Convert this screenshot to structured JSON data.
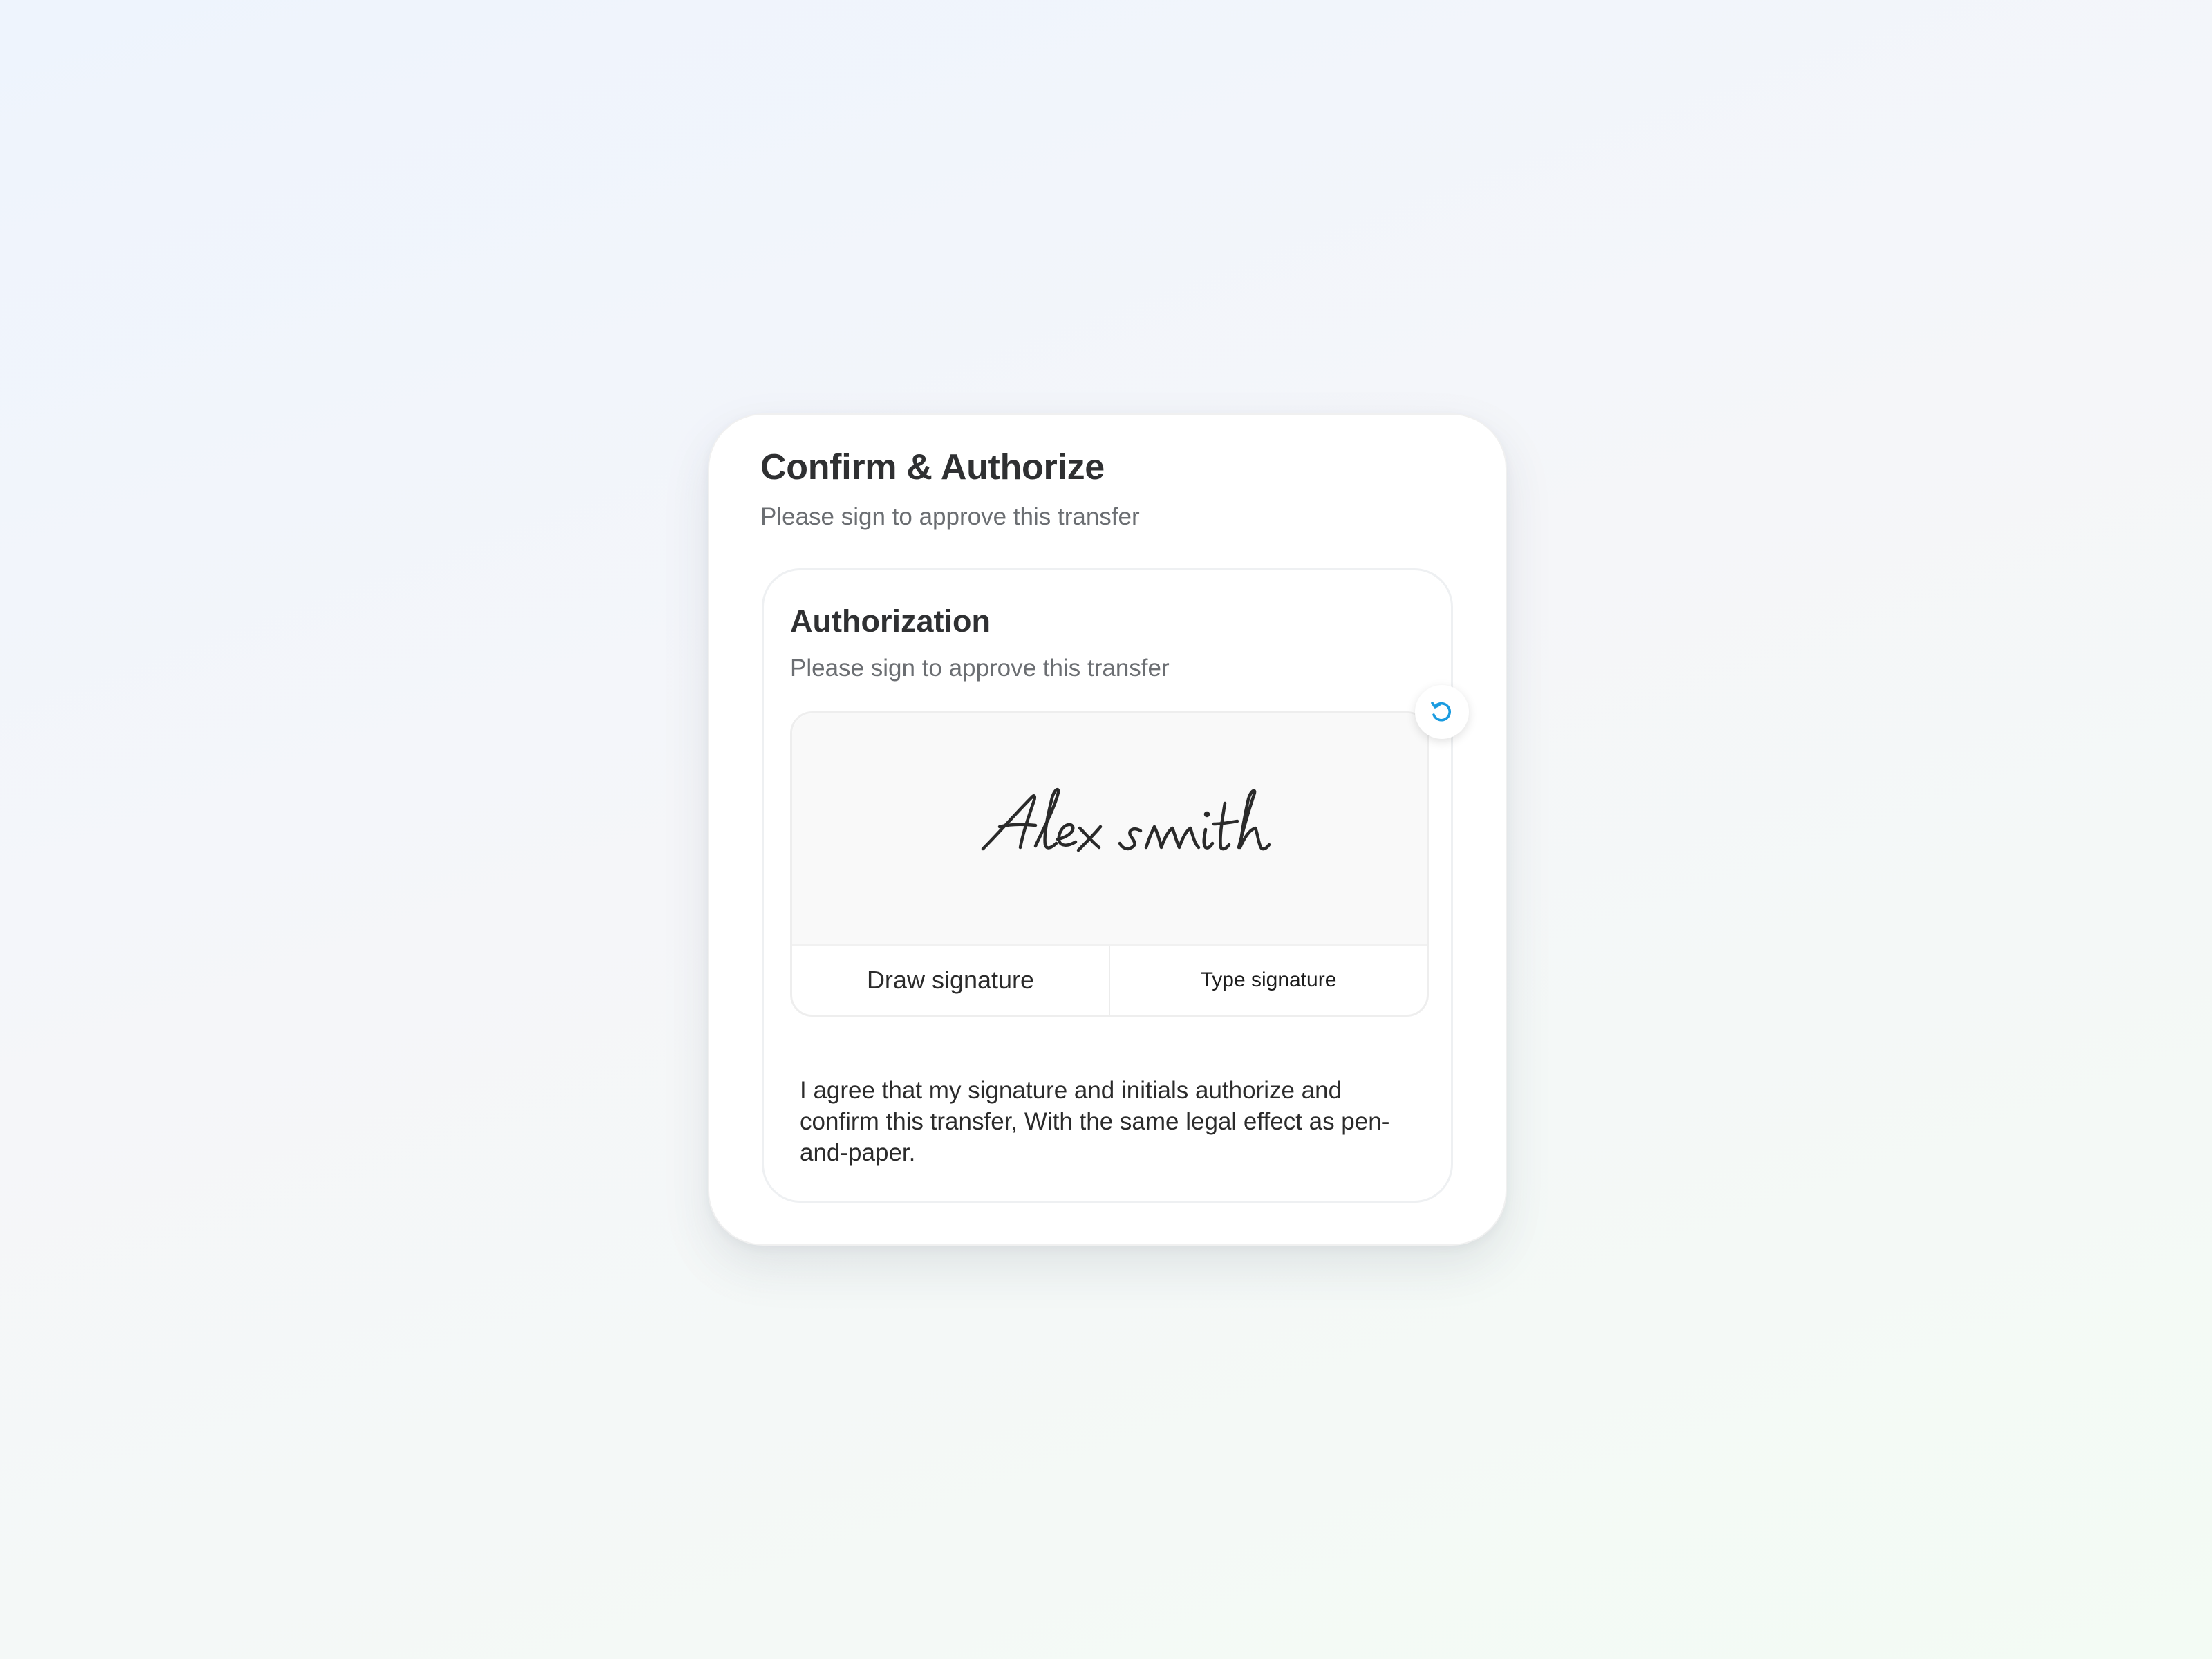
{
  "modal": {
    "title": "Confirm & Authorize",
    "subtitle": "Please sign to approve this transfer"
  },
  "authorization": {
    "title": "Authorization",
    "subtitle": "Please sign to approve this transfer",
    "signature_text": "Alex smith",
    "reset_icon": "reset-icon",
    "tabs": {
      "draw": "Draw signature",
      "type": "Type signature"
    },
    "agreement": "I agree that my signature and initials authorize and confirm this transfer, With the same legal effect as pen-and-paper."
  },
  "colors": {
    "accent": "#1a9be0",
    "title": "#2f3032",
    "muted": "#6b6e72",
    "signature_ink": "#2a2a2a"
  }
}
